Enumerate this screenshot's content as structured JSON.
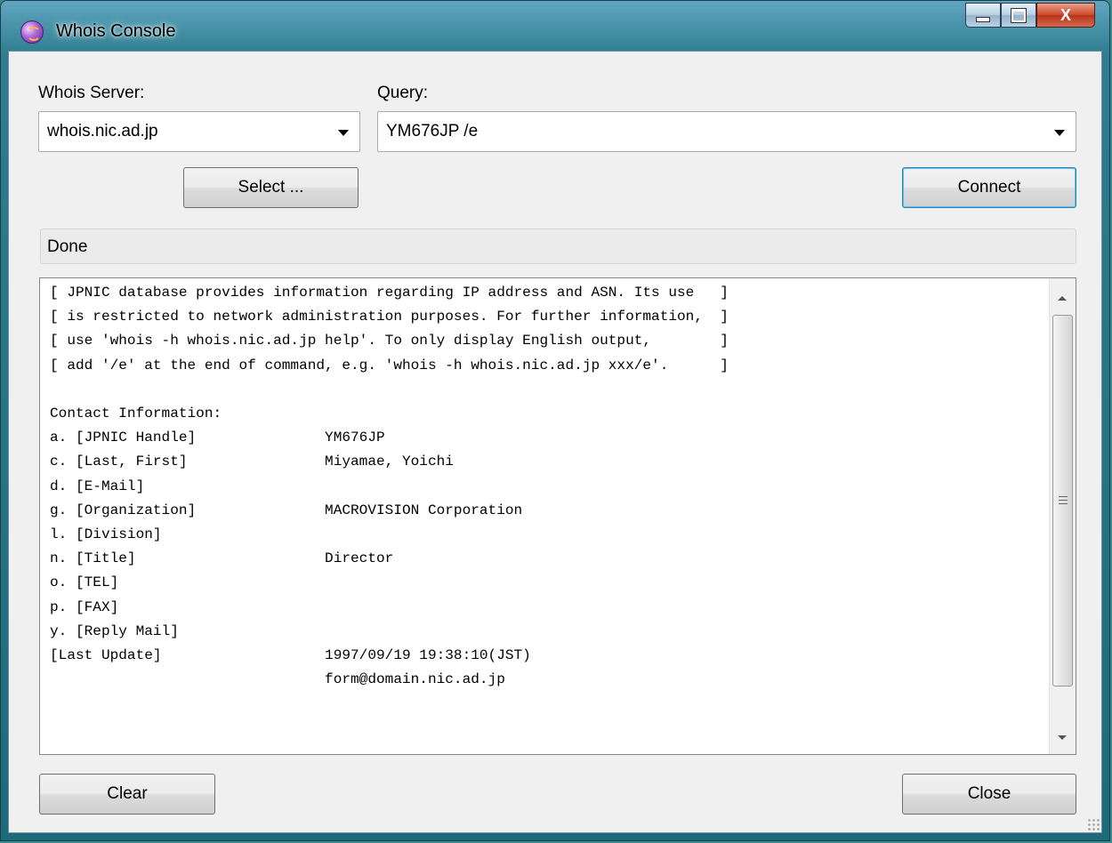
{
  "window": {
    "title": "Whois Console"
  },
  "caption_buttons": {
    "minimize_icon": "minimize-icon",
    "maximize_icon": "maximize-icon",
    "close_label": "X"
  },
  "server": {
    "label": "Whois Server:",
    "value": "whois.nic.ad.jp"
  },
  "query": {
    "label": "Query:",
    "value": "YM676JP /e"
  },
  "buttons": {
    "select": "Select ...",
    "connect": "Connect",
    "clear": "Clear",
    "close": "Close"
  },
  "status": {
    "text": "Done"
  },
  "output": {
    "lines": [
      "[ JPNIC database provides information regarding IP address and ASN. Its use   ]",
      "[ is restricted to network administration purposes. For further information,  ]",
      "[ use 'whois -h whois.nic.ad.jp help'. To only display English output,        ]",
      "[ add '/e' at the end of command, e.g. 'whois -h whois.nic.ad.jp xxx/e'.      ]",
      "",
      "Contact Information:",
      "a. [JPNIC Handle]               YM676JP",
      "c. [Last, First]                Miyamae, Yoichi",
      "d. [E-Mail]",
      "g. [Organization]               MACROVISION Corporation",
      "l. [Division]",
      "n. [Title]                      Director",
      "o. [TEL]",
      "p. [FAX]",
      "y. [Reply Mail]",
      "[Last Update]                   1997/09/19 19:38:10(JST)",
      "                                form@domain.nic.ad.jp"
    ]
  }
}
